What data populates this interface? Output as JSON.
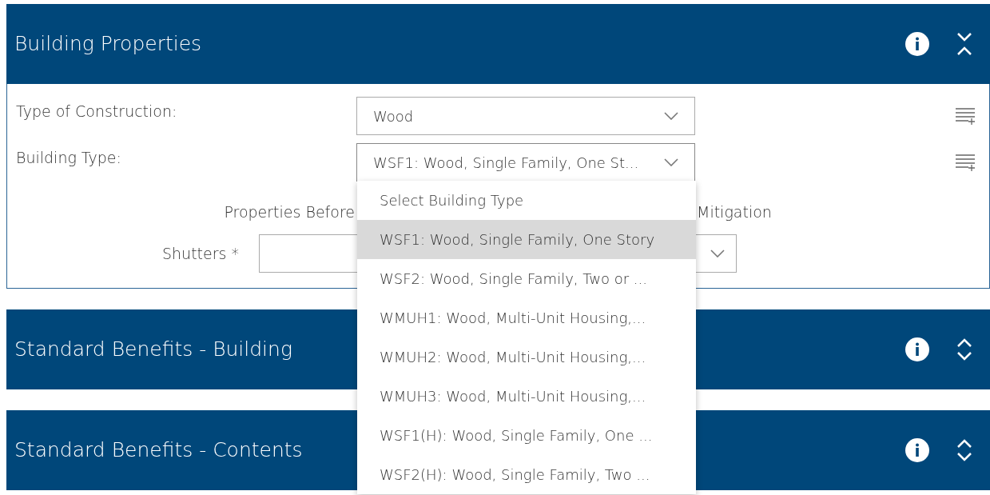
{
  "panels": [
    {
      "title": "Building Properties",
      "expanded": true,
      "fields": [
        {
          "label": "Type of Construction:",
          "value": "Wood",
          "open": false
        },
        {
          "label": "Building Type:",
          "value": "WSF1: Wood, Single Family, One St...",
          "open": true,
          "options": [
            {
              "label": "Select Building Type",
              "selected": false
            },
            {
              "label": "WSF1: Wood, Single Family, One Story",
              "selected": true
            },
            {
              "label": "WSF2: Wood, Single Family, Two or ...",
              "selected": false
            },
            {
              "label": "WMUH1: Wood, Multi-Unit Housing,...",
              "selected": false
            },
            {
              "label": "WMUH2: Wood, Multi-Unit Housing,...",
              "selected": false
            },
            {
              "label": "WMUH3: Wood, Multi-Unit Housing,...",
              "selected": false
            },
            {
              "label": "WSF1(H): Wood, Single Family, One ...",
              "selected": false
            },
            {
              "label": "WSF2(H): Wood, Single Family, Two ...",
              "selected": false
            }
          ]
        }
      ],
      "mitigation": {
        "before_heading": "Properties Before",
        "after_heading": "Mitigation",
        "rows": [
          {
            "label": "Shutters *"
          }
        ]
      }
    },
    {
      "title": "Standard Benefits - Building",
      "expanded": false
    },
    {
      "title": "Standard Benefits - Contents",
      "expanded": false
    }
  ]
}
